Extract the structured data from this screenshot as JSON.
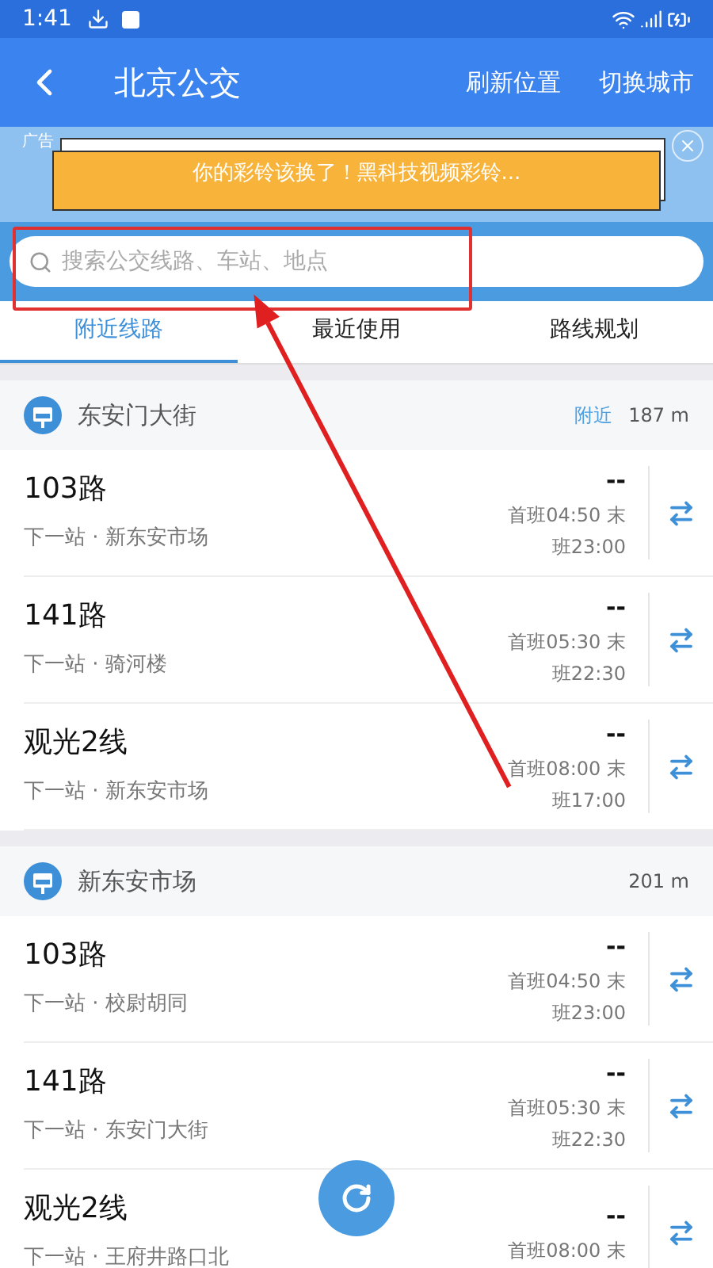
{
  "status_bar": {
    "time": "1:41"
  },
  "app_bar": {
    "title": "北京公交",
    "actions": [
      "刷新位置",
      "切换城市"
    ]
  },
  "ad": {
    "tag": "广告",
    "text": "你的彩铃该换了！黑科技视频彩铃..."
  },
  "search": {
    "placeholder": "搜索公交线路、车站、地点"
  },
  "tabs": [
    {
      "label": "附近线路",
      "selected": true
    },
    {
      "label": "最近使用",
      "selected": false
    },
    {
      "label": "路线规划",
      "selected": false
    }
  ],
  "stations": [
    {
      "name": "东安门大街",
      "nearby": "附近",
      "distance": "187 m",
      "lines": [
        {
          "name": "103路",
          "next_stop": "下一站 · 新东安市场",
          "arrival": "--",
          "schedule": "首班04:50 末班23:00"
        },
        {
          "name": "141路",
          "next_stop": "下一站 · 骑河楼",
          "arrival": "--",
          "schedule": "首班05:30 末班22:30"
        },
        {
          "name": "观光2线",
          "next_stop": "下一站 · 新东安市场",
          "arrival": "--",
          "schedule": "首班08:00 末班17:00"
        }
      ]
    },
    {
      "name": "新东安市场",
      "distance": "201 m",
      "lines": [
        {
          "name": "103路",
          "next_stop": "下一站 · 校尉胡同",
          "arrival": "--",
          "schedule": "首班04:50 末班23:00"
        },
        {
          "name": "141路",
          "next_stop": "下一站 · 东安门大街",
          "arrival": "--",
          "schedule": "首班05:30 末班22:30"
        },
        {
          "name": "观光2线",
          "next_stop": "下一站 · 王府井路口北",
          "arrival": "--",
          "schedule": "首班08:00 末"
        }
      ]
    }
  ]
}
